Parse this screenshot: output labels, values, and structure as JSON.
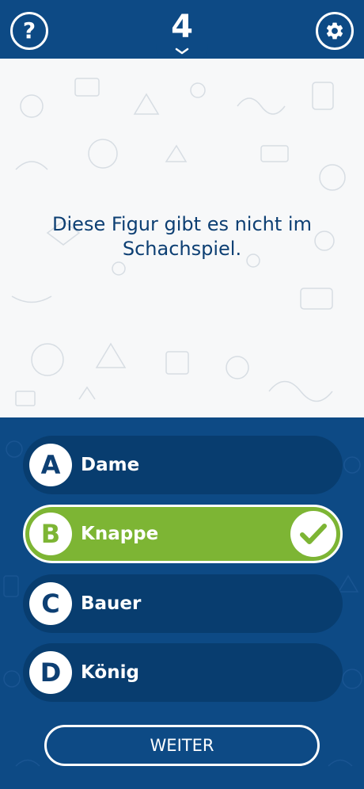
{
  "header": {
    "question_number": "4",
    "help_icon": "question-mark-icon",
    "settings_icon": "gear-icon",
    "color": "#0d4a85"
  },
  "question": {
    "text": "Diese Figur gibt es nicht im Schachspiel."
  },
  "answers": [
    {
      "letter": "A",
      "label": "Dame",
      "state": "default"
    },
    {
      "letter": "B",
      "label": "Knappe",
      "state": "correct"
    },
    {
      "letter": "C",
      "label": "Bauer",
      "state": "default"
    },
    {
      "letter": "D",
      "label": "König",
      "state": "default"
    }
  ],
  "continue_button": {
    "label": "WEITER"
  },
  "colors": {
    "primary": "#0d4a85",
    "answer_bg": "#083d6f",
    "correct": "#7db534",
    "question_text": "#0d3f73"
  }
}
